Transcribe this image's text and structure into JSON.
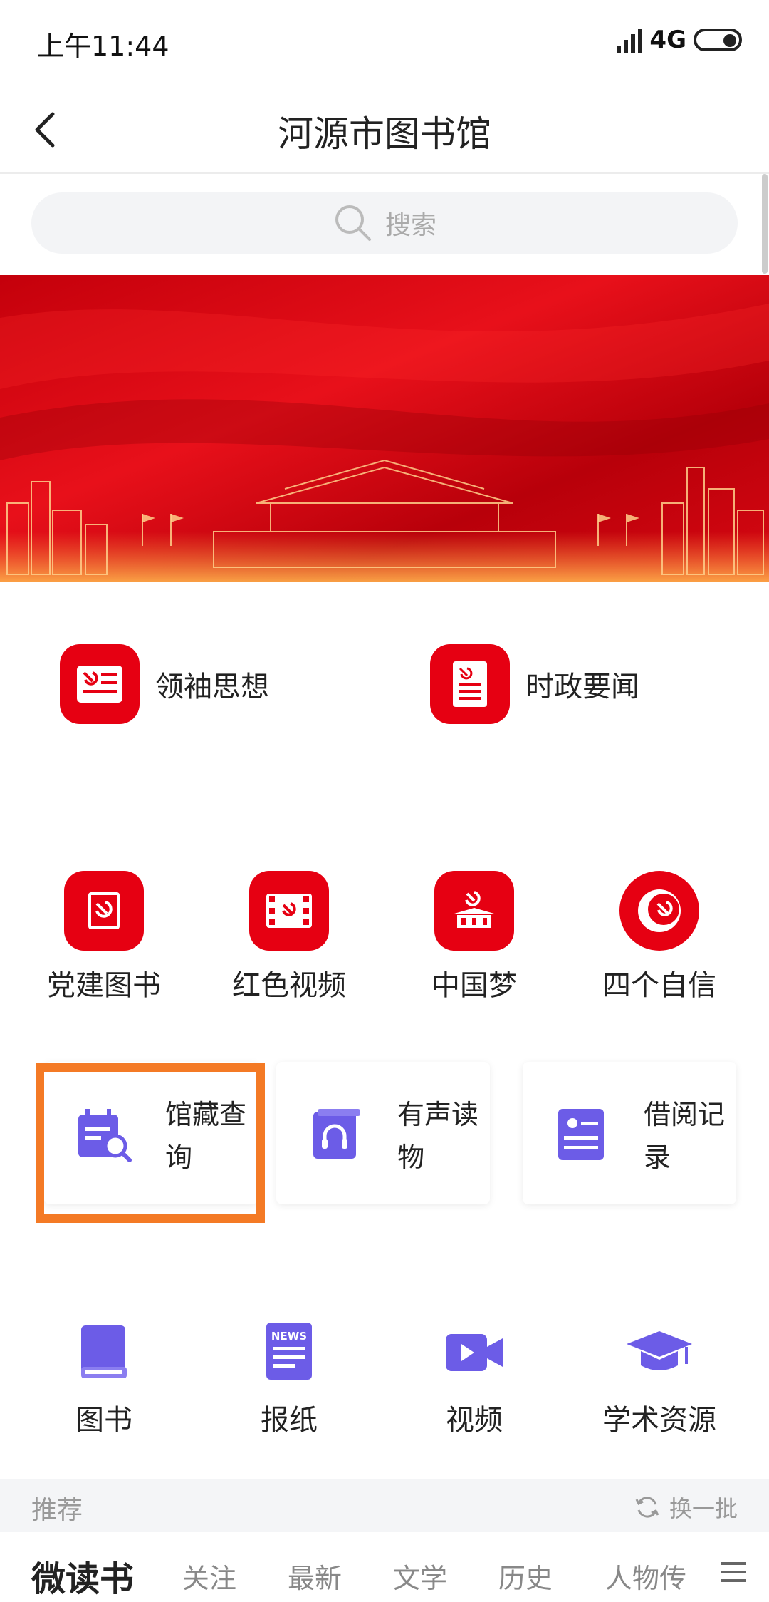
{
  "status": {
    "time": "上午11:44",
    "network": "4G"
  },
  "nav": {
    "title": "河源市图书馆"
  },
  "search": {
    "placeholder": "搜索"
  },
  "party_top": [
    {
      "label": "领袖思想"
    },
    {
      "label": "时政要闻"
    }
  ],
  "party_grid": [
    {
      "label": "党建图书"
    },
    {
      "label": "红色视频"
    },
    {
      "label": "中国梦"
    },
    {
      "label": "四个自信"
    }
  ],
  "cards": [
    {
      "line1": "馆藏查",
      "line2": "询"
    },
    {
      "line1": "有声读",
      "line2": "物"
    },
    {
      "line1": "借阅记",
      "line2": "录"
    }
  ],
  "resources": [
    {
      "label": "图书"
    },
    {
      "label": "报纸",
      "badge": "NEWS"
    },
    {
      "label": "视频"
    },
    {
      "label": "学术资源"
    }
  ],
  "recommend": {
    "label": "推荐",
    "refresh": "换一批"
  },
  "tabs": {
    "brand": "微读书",
    "items": [
      "关注",
      "最新",
      "文学",
      "历史",
      "人物传"
    ]
  },
  "colors": {
    "party_red": "#e60012",
    "accent_purple": "#6c5ce7",
    "highlight_orange": "#f47a25"
  }
}
